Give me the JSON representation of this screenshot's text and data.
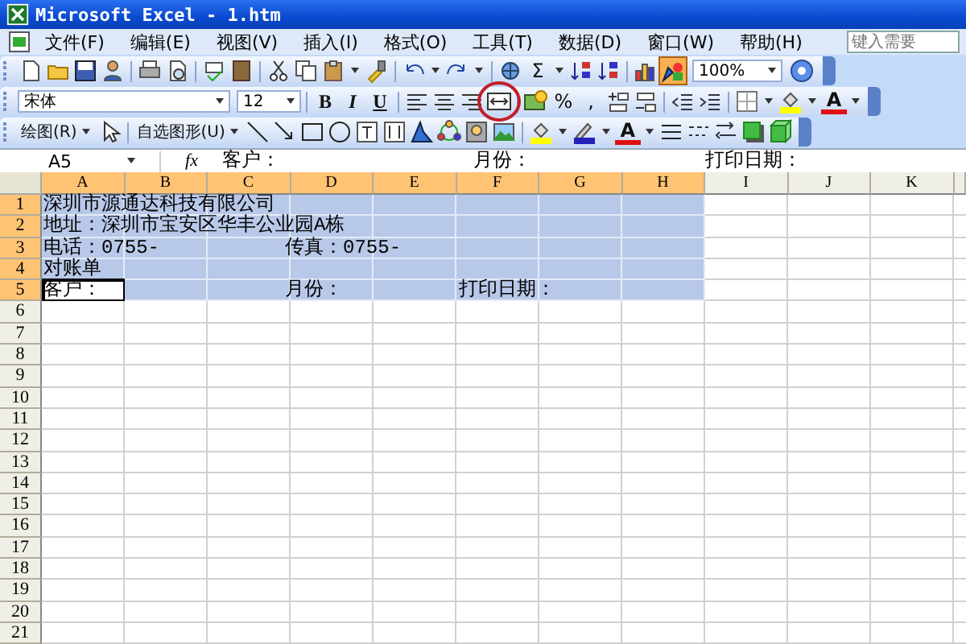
{
  "window": {
    "title": "Microsoft Excel - 1.htm"
  },
  "menu": [
    "文件(F)",
    "编辑(E)",
    "视图(V)",
    "插入(I)",
    "格式(O)",
    "工具(T)",
    "数据(D)",
    "窗口(W)",
    "帮助(H)"
  ],
  "help_box": {
    "placeholder": "键入需要"
  },
  "standard_toolbar": {
    "sum": "Σ",
    "zoom": "100%",
    "drawing_pressed": true
  },
  "formatting_toolbar": {
    "font": "宋体",
    "size": "12",
    "bold": "B",
    "italic": "I",
    "underline": "U",
    "percent": "%",
    "comma": ",",
    "font_color": "A"
  },
  "drawing_toolbar": {
    "draw_menu": "绘图(R)",
    "autoshapes": "自选图形(U)",
    "font_color": "A"
  },
  "formula_bar": {
    "name_box": "A5",
    "fx": "fx",
    "content": "客户：                    月份：                  打印日期："
  },
  "sheet": {
    "columns": [
      {
        "label": "A",
        "selected": true
      },
      {
        "label": "B",
        "selected": true
      },
      {
        "label": "C",
        "selected": true
      },
      {
        "label": "D",
        "selected": true
      },
      {
        "label": "E",
        "selected": true
      },
      {
        "label": "F",
        "selected": true
      },
      {
        "label": "G",
        "selected": true
      },
      {
        "label": "H",
        "selected": true
      },
      {
        "label": "I",
        "selected": false
      },
      {
        "label": "J",
        "selected": false
      },
      {
        "label": "K",
        "selected": false
      }
    ],
    "rows": [
      {
        "label": "1",
        "selected": true,
        "cell_active": false,
        "text": "深圳市源通达科技有限公司"
      },
      {
        "label": "2",
        "selected": true,
        "cell_active": false,
        "text": "地址：深圳市宝安区华丰公业园A栋"
      },
      {
        "label": "3",
        "selected": true,
        "cell_active": false,
        "text": "电话：0755-             传真：0755-"
      },
      {
        "label": "4",
        "selected": true,
        "cell_active": false,
        "text": "对账单"
      },
      {
        "label": "5",
        "selected": true,
        "cell_active": true,
        "text": "客户：                   月份：            打印日期："
      },
      {
        "label": "6",
        "selected": false,
        "cell_active": false
      },
      {
        "label": "7",
        "selected": false,
        "cell_active": false
      },
      {
        "label": "8",
        "selected": false,
        "cell_active": false
      },
      {
        "label": "9",
        "selected": false,
        "cell_active": false
      },
      {
        "label": "10",
        "selected": false,
        "cell_active": false
      },
      {
        "label": "11",
        "selected": false,
        "cell_active": false
      },
      {
        "label": "12",
        "selected": false,
        "cell_active": false
      },
      {
        "label": "13",
        "selected": false,
        "cell_active": false
      },
      {
        "label": "14",
        "selected": false,
        "cell_active": false
      },
      {
        "label": "15",
        "selected": false,
        "cell_active": false
      },
      {
        "label": "16",
        "selected": false,
        "cell_active": false
      },
      {
        "label": "17",
        "selected": false,
        "cell_active": false
      },
      {
        "label": "18",
        "selected": false,
        "cell_active": false
      },
      {
        "label": "19",
        "selected": false,
        "cell_active": false
      },
      {
        "label": "20",
        "selected": false,
        "cell_active": false
      },
      {
        "label": "21",
        "selected": false,
        "cell_active": false
      }
    ]
  }
}
